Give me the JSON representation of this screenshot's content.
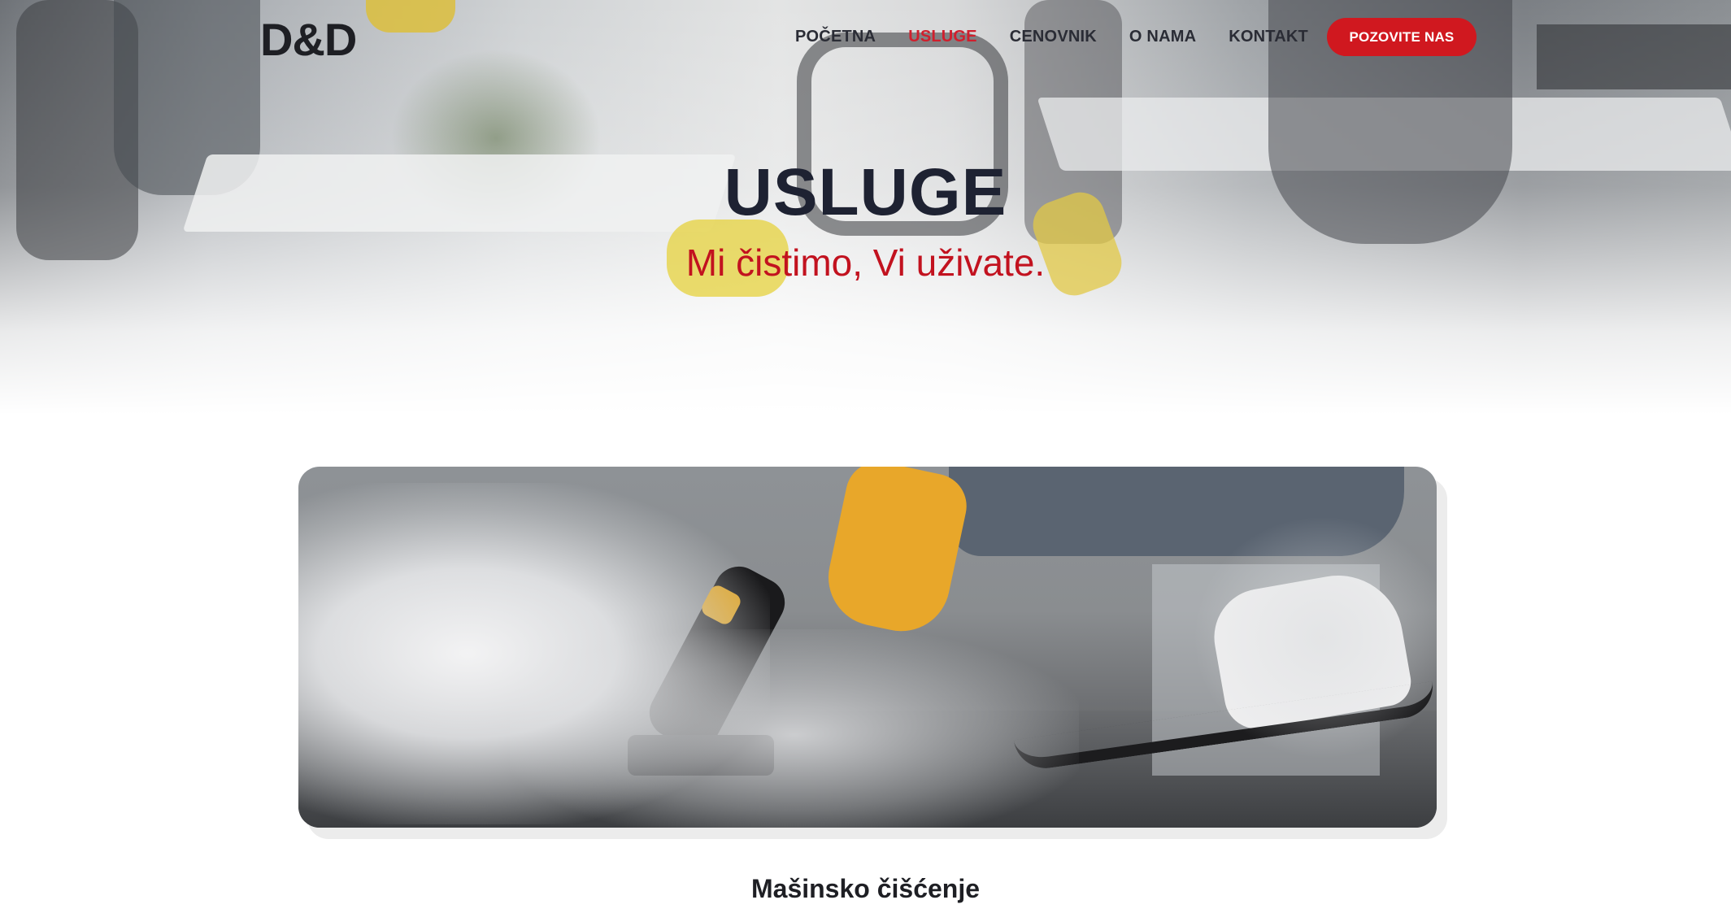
{
  "brand": {
    "logo_text": "D&D"
  },
  "nav": {
    "items": [
      {
        "label": "POČETNA",
        "active": false
      },
      {
        "label": "USLUGE",
        "active": true
      },
      {
        "label": "CENOVNIK",
        "active": false
      },
      {
        "label": "O NAMA",
        "active": false
      },
      {
        "label": "KONTAKT",
        "active": false
      }
    ],
    "cta_label": "POZOVITE NAS"
  },
  "hero": {
    "title": "USLUGE",
    "subtitle": "Mi čistimo, Vi uživate."
  },
  "services": [
    {
      "title": "Mašinsko čišćenje"
    }
  ],
  "colors": {
    "accent": "#d0181f",
    "heading": "#1e2232",
    "subtitle": "#c2121f"
  }
}
